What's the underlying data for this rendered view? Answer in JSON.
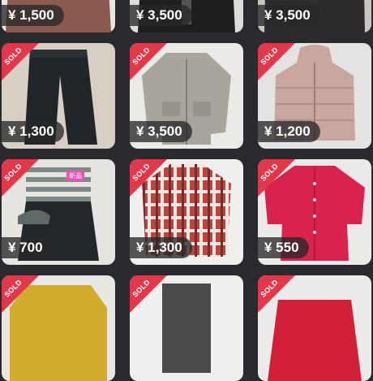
{
  "items": [
    {
      "price": "¥ 1,500",
      "sold": false,
      "name": "brown-top-item"
    },
    {
      "price": "¥ 3,500",
      "sold": false,
      "name": "black-jacket-item"
    },
    {
      "price": "¥ 3,500",
      "sold": false,
      "name": "dark-coat-item"
    },
    {
      "price": "¥ 1,300",
      "sold": true,
      "sold_label": "SOLD",
      "name": "black-pants-item"
    },
    {
      "price": "¥ 3,500",
      "sold": true,
      "sold_label": "SOLD",
      "name": "gray-jacket-item"
    },
    {
      "price": "¥ 1,200",
      "sold": true,
      "sold_label": "SOLD",
      "name": "pink-down-coat-item"
    },
    {
      "price": "¥ 700",
      "sold": true,
      "sold_label": "SOLD",
      "badge": "新品",
      "name": "striped-dress-item"
    },
    {
      "price": "¥ 1,300",
      "sold": true,
      "sold_label": "SOLD",
      "name": "plaid-shirt-item"
    },
    {
      "price": "¥ 550",
      "sold": true,
      "sold_label": "SOLD",
      "name": "red-cardigan-item"
    },
    {
      "price": "",
      "sold": true,
      "sold_label": "SOLD",
      "name": "yellow-sweater-item"
    },
    {
      "price": "",
      "sold": true,
      "sold_label": "SOLD",
      "name": "gray-shorts-item"
    },
    {
      "price": "",
      "sold": true,
      "sold_label": "SOLD",
      "name": "red-top-item"
    }
  ],
  "colors": {
    "sold_ribbon": "#e1384b",
    "background": "#2a2a2e"
  }
}
